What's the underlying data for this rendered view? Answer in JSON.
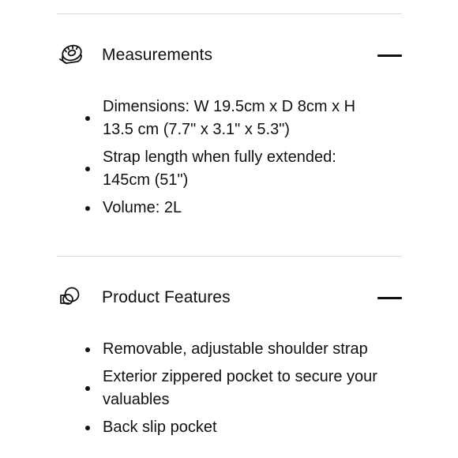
{
  "sections": [
    {
      "title": "Measurements",
      "icon": "measuring-tape-icon",
      "toggle": "collapse",
      "items": [
        "Dimensions: W 19.5cm x D 8cm x H 13.5 cm (7.7\" x 3.1\" x 5.3\")",
        "Strap length when fully extended: 145cm (51\")",
        "Volume: 2L"
      ]
    },
    {
      "title": "Product Features",
      "icon": "overlapping-shapes-icon",
      "toggle": "collapse",
      "items": [
        "Removable, adjustable shoulder strap",
        "Exterior zippered pocket to secure your valuables",
        "Back slip pocket"
      ]
    }
  ]
}
